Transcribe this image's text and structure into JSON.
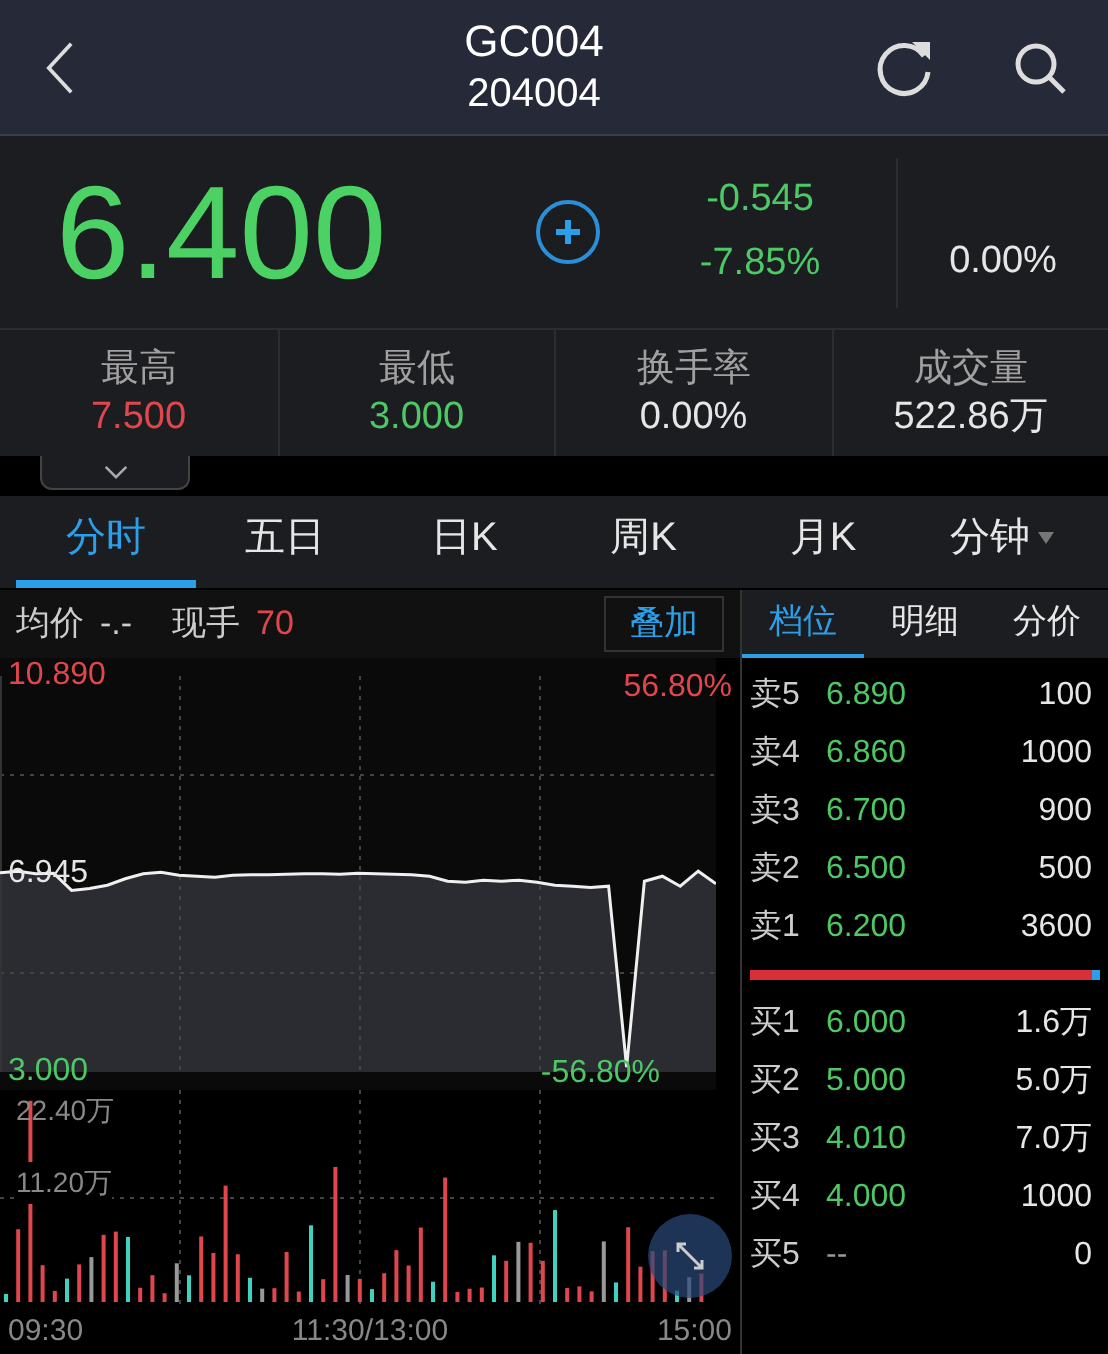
{
  "header": {
    "title": "GC004",
    "code": "204004"
  },
  "quote": {
    "price": "6.400",
    "change": "-0.545",
    "change_pct": "-7.85%",
    "extra": "0.00%"
  },
  "stats": [
    {
      "label": "最高",
      "value": "7.500",
      "color": "#e0474c"
    },
    {
      "label": "最低",
      "value": "3.000",
      "color": "#4cc864"
    },
    {
      "label": "换手率",
      "value": "0.00%",
      "color": "#e6e6e6"
    },
    {
      "label": "成交量",
      "value": "522.86万",
      "color": "#e6e6e6"
    }
  ],
  "tabs": [
    {
      "label": "分时",
      "selected": true,
      "dropdown": false
    },
    {
      "label": "五日",
      "selected": false,
      "dropdown": false
    },
    {
      "label": "日K",
      "selected": false,
      "dropdown": false
    },
    {
      "label": "周K",
      "selected": false,
      "dropdown": false
    },
    {
      "label": "月K",
      "selected": false,
      "dropdown": false
    },
    {
      "label": "分钟",
      "selected": false,
      "dropdown": true
    }
  ],
  "info": {
    "avg_label": "均价",
    "avg_value": "-.-",
    "hand_label": "现手",
    "hand_value": "70",
    "overlay_button": "叠加"
  },
  "chart": {
    "pct_high": "56.80%",
    "pct_low": "-56.80%",
    "volume_high": "22.40万",
    "volume_half": "11.20万",
    "times": [
      "09:30",
      "11:30/13:00",
      "15:00"
    ],
    "chart_data": {
      "type": "line",
      "grid": true,
      "ylim": [
        3.0,
        10.89
      ],
      "yticks": [
        {
          "value": 10.89,
          "label": "10.890"
        },
        {
          "value": 6.945,
          "label": "6.945"
        },
        {
          "value": 3.0,
          "label": "3.000"
        }
      ],
      "series": [
        {
          "color": "#f0f0f0",
          "values": [
            6.97,
            7.0,
            6.95,
            6.96,
            6.62,
            6.66,
            6.72,
            6.85,
            6.95,
            6.98,
            6.92,
            6.9,
            6.88,
            6.92,
            6.93,
            6.93,
            6.94,
            6.95,
            6.95,
            6.94,
            6.96,
            6.95,
            6.94,
            6.93,
            6.9,
            6.8,
            6.78,
            6.82,
            6.8,
            6.82,
            6.78,
            6.72,
            6.7,
            6.68,
            6.7,
            3.1,
            6.8,
            6.9,
            6.7,
            7.0,
            6.75
          ]
        }
      ]
    }
  },
  "book": {
    "tabs": [
      {
        "label": "档位",
        "selected": true
      },
      {
        "label": "明细",
        "selected": false
      },
      {
        "label": "分价",
        "selected": false
      }
    ],
    "sell": [
      {
        "label": "卖5",
        "price": "6.890",
        "volume": "100"
      },
      {
        "label": "卖4",
        "price": "6.860",
        "volume": "1000"
      },
      {
        "label": "卖3",
        "price": "6.700",
        "volume": "900"
      },
      {
        "label": "卖2",
        "price": "6.500",
        "volume": "500"
      },
      {
        "label": "卖1",
        "price": "6.200",
        "volume": "3600"
      }
    ],
    "buy": [
      {
        "label": "买1",
        "price": "6.000",
        "volume": "1.6万"
      },
      {
        "label": "买2",
        "price": "5.000",
        "volume": "5.0万"
      },
      {
        "label": "买3",
        "price": "4.010",
        "volume": "7.0万"
      },
      {
        "label": "买4",
        "price": "4.000",
        "volume": "1000"
      },
      {
        "label": "买5",
        "price": "--",
        "volume": "0"
      }
    ]
  }
}
